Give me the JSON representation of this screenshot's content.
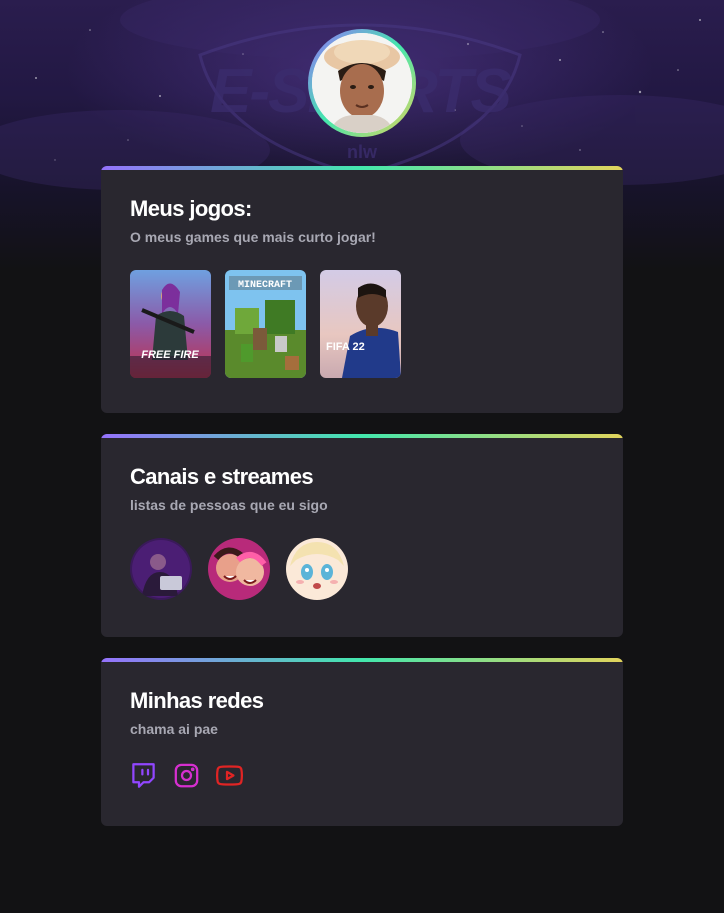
{
  "hero": {
    "brand_logo": "E-SPORTS",
    "brand_sub": "nlw"
  },
  "profile": {
    "avatar": "user-avatar"
  },
  "games_card": {
    "title": "Meus jogos:",
    "subtitle": "O meus games que mais curto jogar!",
    "games": [
      {
        "name": "Free Fire",
        "cover_text": "FREE FIRE",
        "icon": "free-fire-cover"
      },
      {
        "name": "Minecraft",
        "cover_text": "MINECRAFT",
        "icon": "minecraft-cover"
      },
      {
        "name": "FIFA 22",
        "cover_text": "FIFA 22",
        "icon": "fifa-22-cover"
      }
    ]
  },
  "channels_card": {
    "title": "Canais e streames",
    "subtitle": "listas de pessoas que eu sigo",
    "channels": [
      {
        "icon": "streamer-avatar-1"
      },
      {
        "icon": "streamer-avatar-2"
      },
      {
        "icon": "streamer-avatar-3"
      }
    ]
  },
  "social_card": {
    "title": "Minhas redes",
    "subtitle": "chama ai pae",
    "links": [
      {
        "icon": "twitch-icon",
        "color": "#9146ff"
      },
      {
        "icon": "instagram-icon",
        "color": "#d62fd0"
      },
      {
        "icon": "youtube-icon",
        "color": "#e02424"
      }
    ]
  },
  "colors": {
    "background": "#121214",
    "card": "#29272f",
    "title": "#ffffff",
    "subtitle": "#a8a8b3",
    "gradient": [
      "#9572fc",
      "#43e7ad",
      "#e2d45c"
    ]
  }
}
